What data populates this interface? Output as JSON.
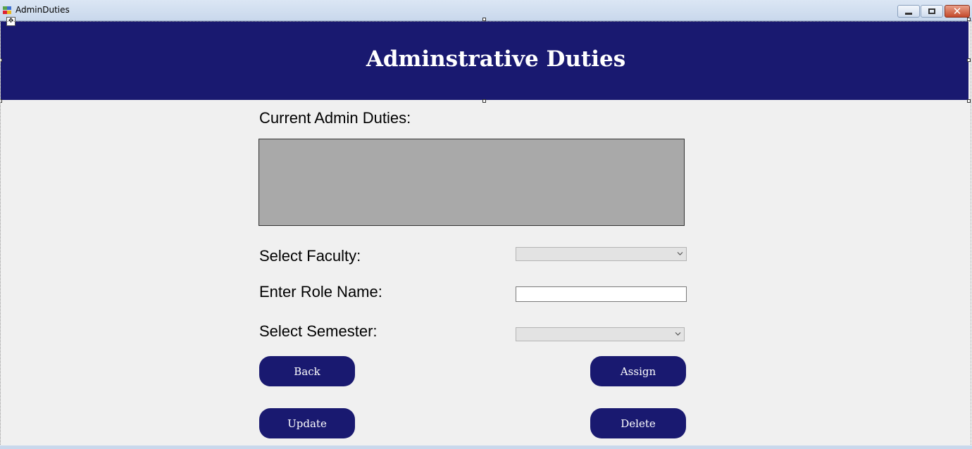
{
  "window": {
    "title": "AdminDuties",
    "controls": {
      "minimize": "minimize",
      "maximize": "maximize",
      "close": "✕"
    }
  },
  "header": {
    "title": "Adminstrative Duties",
    "background_color": "#191970"
  },
  "form": {
    "current_duties_label": "Current Admin Duties:",
    "select_faculty_label": "Select Faculty:",
    "faculty_selected": "",
    "role_name_label": "Enter Role Name:",
    "role_name_value": "",
    "select_semester_label": "Select Semester:",
    "semester_selected": ""
  },
  "buttons": {
    "back": "Back",
    "assign": "Assign",
    "update": "Update",
    "delete": "Delete"
  },
  "colors": {
    "button_bg": "#191970",
    "grid_bg": "#a9a9a9",
    "form_bg": "#f0f0f0"
  }
}
